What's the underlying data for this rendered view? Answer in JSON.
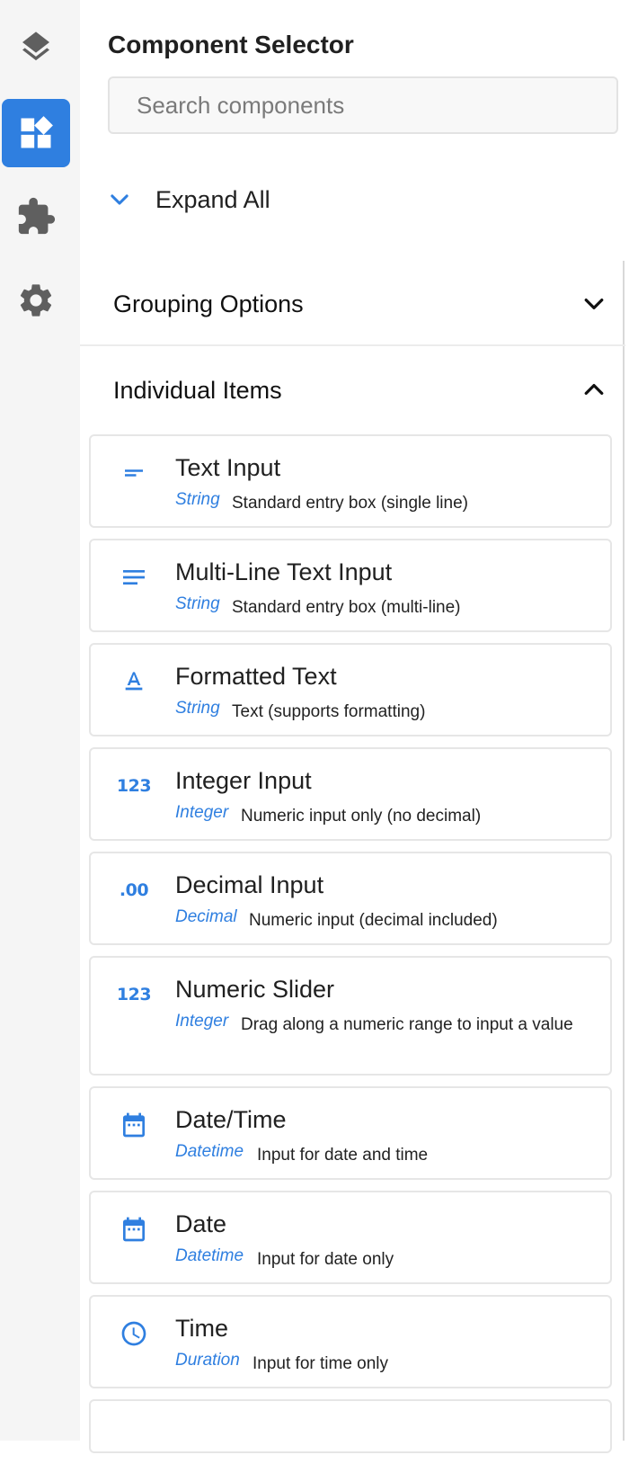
{
  "rail": {
    "items": [
      {
        "icon": "layers-icon"
      },
      {
        "icon": "widgets-icon",
        "active": true
      },
      {
        "icon": "puzzle-icon"
      },
      {
        "icon": "gear-icon"
      }
    ]
  },
  "panel": {
    "title": "Component Selector",
    "search_placeholder": "Search components",
    "expand_all_label": "Expand All",
    "sections": {
      "grouping": {
        "label": "Grouping Options",
        "expanded": false
      },
      "individual": {
        "label": "Individual Items",
        "expanded": true
      }
    }
  },
  "items": [
    {
      "name": "Text Input",
      "type": "String",
      "desc": "Standard entry box (single line)",
      "icon": "short-text-icon"
    },
    {
      "name": "Multi-Line Text Input",
      "type": "String",
      "desc": "Standard entry box (multi-line)",
      "icon": "notes-icon"
    },
    {
      "name": "Formatted Text",
      "type": "String",
      "desc": "Text (supports formatting)",
      "icon": "format-text-icon"
    },
    {
      "name": "Integer Input",
      "type": "Integer",
      "desc": "Numeric input only (no decimal)",
      "icon": "numbers-icon",
      "glyph": "123"
    },
    {
      "name": "Decimal Input",
      "type": "Decimal",
      "desc": "Numeric input (decimal included)",
      "icon": "decimal-icon",
      "glyph": ".00"
    },
    {
      "name": "Numeric Slider",
      "type": "Integer",
      "desc": "Drag along a numeric range to input a value",
      "icon": "numbers-icon",
      "glyph": "123"
    },
    {
      "name": "Date/Time",
      "type": "Datetime",
      "desc": "Input for date and time",
      "icon": "calendar-icon"
    },
    {
      "name": "Date",
      "type": "Datetime",
      "desc": "Input for date only",
      "icon": "calendar-icon"
    },
    {
      "name": "Time",
      "type": "Duration",
      "desc": "Input for time only",
      "icon": "clock-icon"
    }
  ],
  "colors": {
    "accent": "#2f7fe0",
    "rail_bg": "#f5f5f5",
    "icon_gray": "#616161"
  }
}
